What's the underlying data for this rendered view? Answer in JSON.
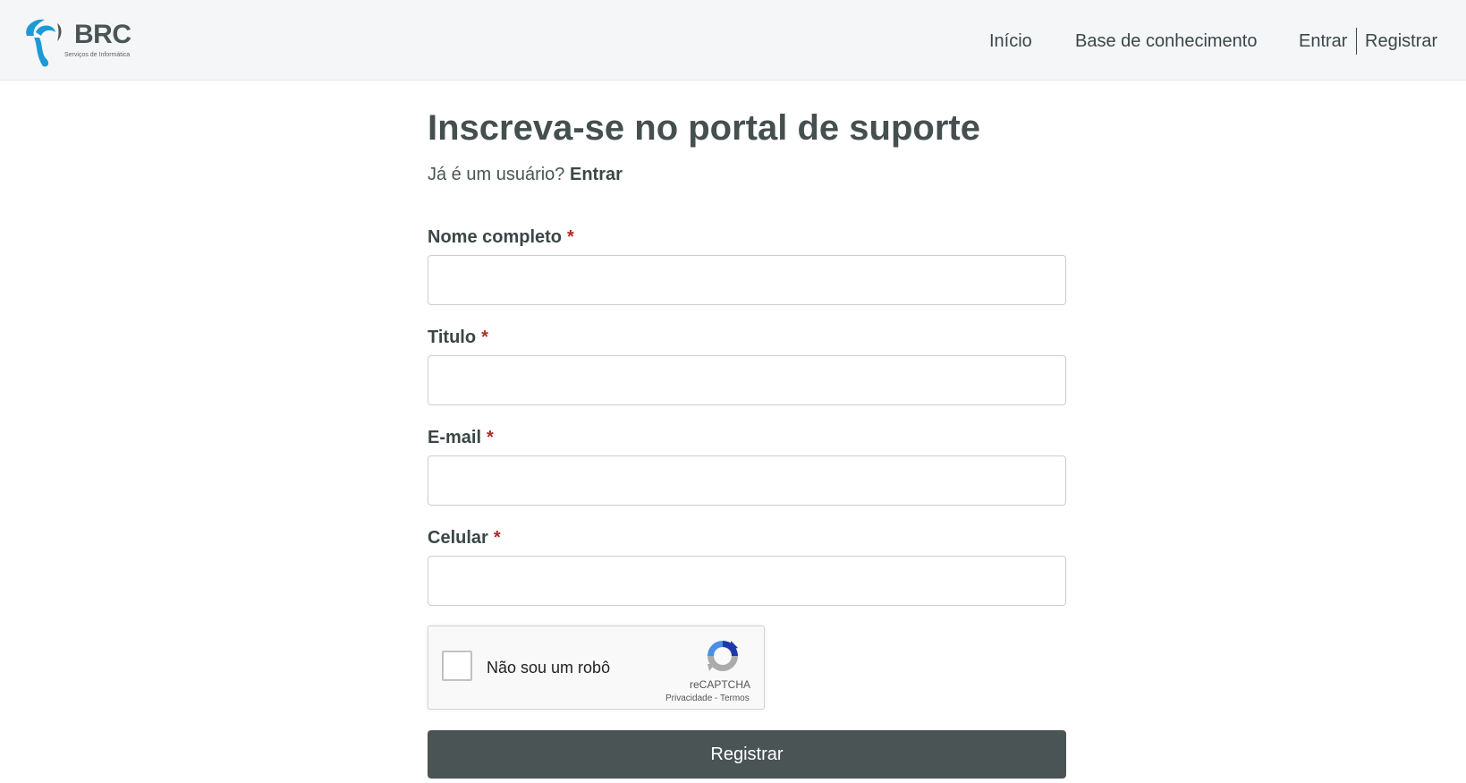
{
  "brand": {
    "logo_text": "BRC",
    "tagline": "Serviços de Informática",
    "colors": {
      "logo_blue": "#1c9ad6",
      "logo_text": "#4b5556"
    }
  },
  "nav": {
    "items": [
      {
        "label": "Início"
      },
      {
        "label": "Base de conhecimento"
      }
    ],
    "login_label": "Entrar",
    "register_label": "Registrar"
  },
  "page": {
    "title": "Inscreva-se no portal de suporte",
    "already_user_text": "Já é um usuário?",
    "login_link_label": "Entrar"
  },
  "form": {
    "required_marker": "*",
    "fields": [
      {
        "label": "Nome completo",
        "value": "",
        "placeholder": ""
      },
      {
        "label": "Titulo",
        "value": "",
        "placeholder": ""
      },
      {
        "label": "E-mail",
        "value": "",
        "placeholder": ""
      },
      {
        "label": "Celular",
        "value": "",
        "placeholder": ""
      }
    ],
    "submit_label": "Registrar"
  },
  "captcha": {
    "label": "Não sou um robô",
    "brand": "reCAPTCHA",
    "links": "Privacidade - Termos",
    "icon": "recaptcha-icon"
  },
  "colors": {
    "button_bg": "#4a5455",
    "required": "#b22a2a",
    "text": "#4b5556"
  }
}
